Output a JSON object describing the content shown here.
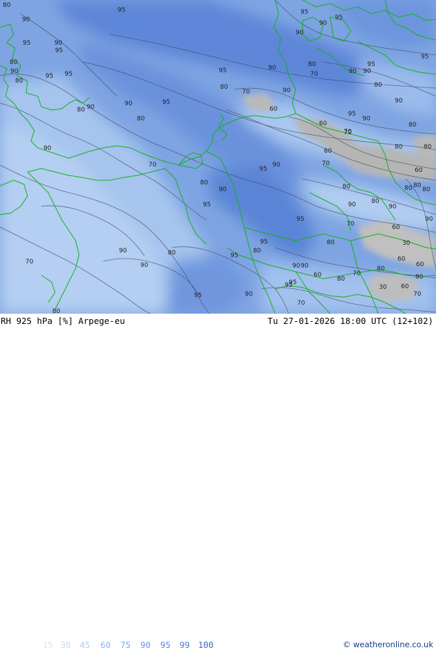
{
  "map": {
    "product_label": "RH 925 hPa [%] Arpege-eu",
    "valid_time": "Tu 27-01-2026 18:00 UTC (12+102)",
    "credit": "© weatheronline.co.uk",
    "legend_values": [
      "15",
      "30",
      "45",
      "60",
      "75",
      "90",
      "95",
      "99",
      "100"
    ],
    "legend_colors": [
      "#d9e6f7",
      "#c4d8f2",
      "#b2cdee",
      "#8fb8ea",
      "#7eaae6",
      "#6a99e0",
      "#5b8ad9",
      "#4a7bd2",
      "#3b6ccc"
    ],
    "contour_labels": [
      "80",
      "90",
      "95",
      "95",
      "90",
      "95",
      "90",
      "95",
      "90",
      "95",
      "80",
      "95",
      "90",
      "80",
      "95",
      "95",
      "90",
      "80",
      "95",
      "95",
      "70",
      "90",
      "90",
      "80",
      "70",
      "90",
      "80",
      "90",
      "70",
      "95",
      "90",
      "60",
      "90",
      "80",
      "80",
      "90",
      "60",
      "95",
      "90",
      "80",
      "70",
      "80",
      "80",
      "90",
      "70",
      "95",
      "90",
      "80",
      "60",
      "70",
      "80",
      "80",
      "90",
      "90",
      "60",
      "80",
      "95",
      "95",
      "70",
      "80",
      "60",
      "80",
      "95",
      "90",
      "90",
      "80",
      "80",
      "70",
      "60",
      "90",
      "30",
      "80",
      "60",
      "90",
      "95",
      "80",
      "90",
      "95",
      "80",
      "70",
      "60",
      "30",
      "80",
      "90",
      "95",
      "95",
      "70",
      "60",
      "70",
      "80"
    ]
  }
}
